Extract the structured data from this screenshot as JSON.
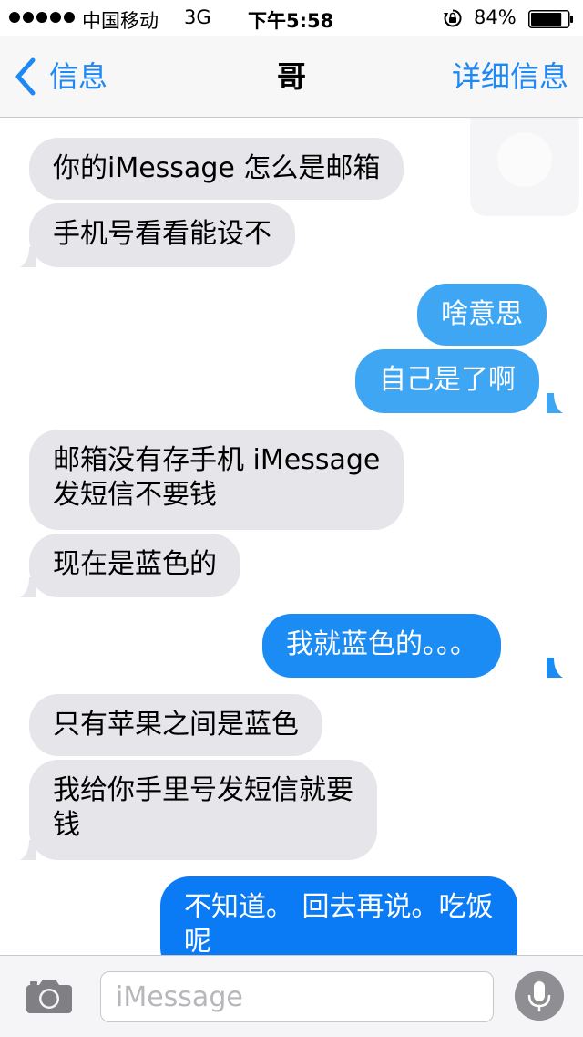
{
  "status_bar": {
    "carrier": "中国移动",
    "network": "3G",
    "time": "下午5:58",
    "battery_percent": "84%",
    "battery_level": 0.84,
    "signal_bars": 5,
    "icons": [
      "signal-dots-icon",
      "orientation-lock-icon",
      "battery-icon"
    ]
  },
  "nav": {
    "back_label": "信息",
    "title": "哥",
    "details_label": "详细信息"
  },
  "messages": [
    {
      "direction": "incoming",
      "text": "你的iMessage 怎么是邮箱"
    },
    {
      "direction": "incoming",
      "text": "手机号看看能设不"
    },
    {
      "direction": "outgoing",
      "text": "啥意思"
    },
    {
      "direction": "outgoing",
      "text": "自己是了啊"
    },
    {
      "direction": "incoming",
      "text": "邮箱没有存手机 iMessage\n发短信不要钱"
    },
    {
      "direction": "incoming",
      "text": "现在是蓝色的"
    },
    {
      "direction": "outgoing",
      "text": "我就蓝色的。。。"
    },
    {
      "direction": "incoming",
      "text": "只有苹果之间是蓝色"
    },
    {
      "direction": "incoming",
      "text": "我给你手里号发短信就要\n钱"
    },
    {
      "direction": "outgoing",
      "text": "不知道。 回去再说。吃饭\n呢"
    }
  ],
  "input_bar": {
    "placeholder": "iMessage",
    "icons": [
      "camera-icon",
      "microphone-icon"
    ]
  },
  "colors": {
    "ios_blue": "#1e88f4",
    "incoming_bubble": "#e5e5ea",
    "outgoing_bubble_light": "#3fa6f4",
    "outgoing_bubble_mid": "#1a8cf4",
    "outgoing_bubble_deep": "#0b7bf5"
  }
}
